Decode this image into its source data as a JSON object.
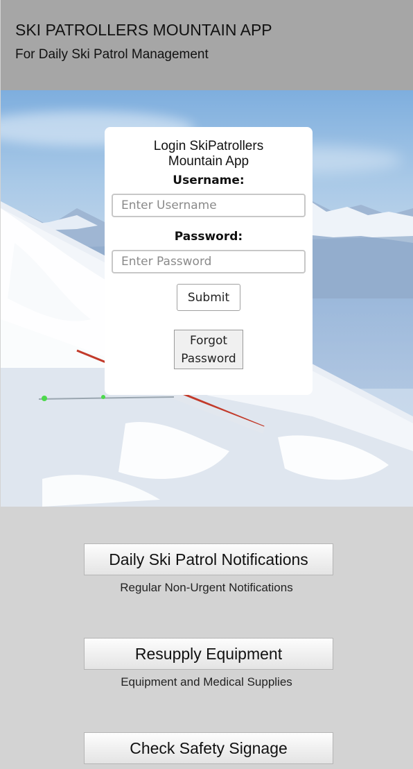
{
  "header": {
    "title": "SKI PATROLLERS MOUNTAIN APP",
    "subtitle": "For Daily Ski Patrol Management"
  },
  "login": {
    "title_line1": "Login SkiPatrollers",
    "title_line2": "Mountain App",
    "username_label": "Username:",
    "username_placeholder": "Enter Username",
    "username_value": "",
    "password_label": "Password:",
    "password_placeholder": "Enter Password",
    "password_value": "",
    "submit_label": "Submit",
    "forgot_line1": "Forgot",
    "forgot_line2": "Password"
  },
  "actions": [
    {
      "label": "Daily Ski Patrol Notifications",
      "description": "Regular Non-Urgent Notifications"
    },
    {
      "label": "Resupply Equipment",
      "description": "Equipment and Medical Supplies"
    },
    {
      "label": "Check Safety Signage"
    }
  ],
  "colors": {
    "header_bg": "#a6a6a6",
    "page_bg": "#d3d3d3",
    "card_bg": "#ffffff"
  }
}
